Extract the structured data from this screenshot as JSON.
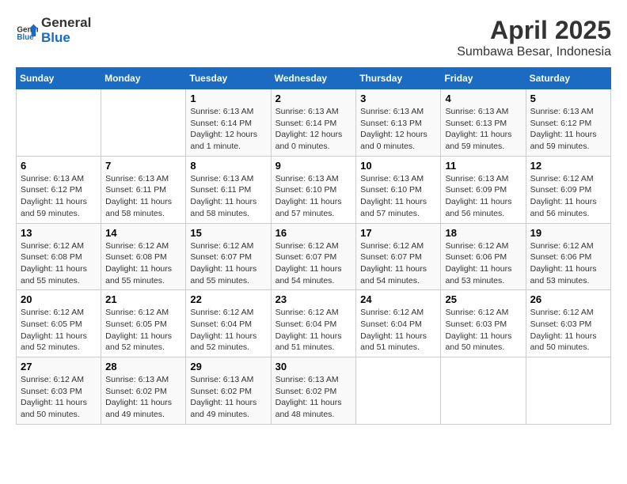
{
  "logo": {
    "line1": "General",
    "line2": "Blue"
  },
  "title": "April 2025",
  "subtitle": "Sumbawa Besar, Indonesia",
  "days_of_week": [
    "Sunday",
    "Monday",
    "Tuesday",
    "Wednesday",
    "Thursday",
    "Friday",
    "Saturday"
  ],
  "weeks": [
    [
      {
        "day": "",
        "info": ""
      },
      {
        "day": "",
        "info": ""
      },
      {
        "day": "1",
        "info": "Sunrise: 6:13 AM\nSunset: 6:14 PM\nDaylight: 12 hours and 1 minute."
      },
      {
        "day": "2",
        "info": "Sunrise: 6:13 AM\nSunset: 6:14 PM\nDaylight: 12 hours and 0 minutes."
      },
      {
        "day": "3",
        "info": "Sunrise: 6:13 AM\nSunset: 6:13 PM\nDaylight: 12 hours and 0 minutes."
      },
      {
        "day": "4",
        "info": "Sunrise: 6:13 AM\nSunset: 6:13 PM\nDaylight: 11 hours and 59 minutes."
      },
      {
        "day": "5",
        "info": "Sunrise: 6:13 AM\nSunset: 6:12 PM\nDaylight: 11 hours and 59 minutes."
      }
    ],
    [
      {
        "day": "6",
        "info": "Sunrise: 6:13 AM\nSunset: 6:12 PM\nDaylight: 11 hours and 59 minutes."
      },
      {
        "day": "7",
        "info": "Sunrise: 6:13 AM\nSunset: 6:11 PM\nDaylight: 11 hours and 58 minutes."
      },
      {
        "day": "8",
        "info": "Sunrise: 6:13 AM\nSunset: 6:11 PM\nDaylight: 11 hours and 58 minutes."
      },
      {
        "day": "9",
        "info": "Sunrise: 6:13 AM\nSunset: 6:10 PM\nDaylight: 11 hours and 57 minutes."
      },
      {
        "day": "10",
        "info": "Sunrise: 6:13 AM\nSunset: 6:10 PM\nDaylight: 11 hours and 57 minutes."
      },
      {
        "day": "11",
        "info": "Sunrise: 6:13 AM\nSunset: 6:09 PM\nDaylight: 11 hours and 56 minutes."
      },
      {
        "day": "12",
        "info": "Sunrise: 6:12 AM\nSunset: 6:09 PM\nDaylight: 11 hours and 56 minutes."
      }
    ],
    [
      {
        "day": "13",
        "info": "Sunrise: 6:12 AM\nSunset: 6:08 PM\nDaylight: 11 hours and 55 minutes."
      },
      {
        "day": "14",
        "info": "Sunrise: 6:12 AM\nSunset: 6:08 PM\nDaylight: 11 hours and 55 minutes."
      },
      {
        "day": "15",
        "info": "Sunrise: 6:12 AM\nSunset: 6:07 PM\nDaylight: 11 hours and 55 minutes."
      },
      {
        "day": "16",
        "info": "Sunrise: 6:12 AM\nSunset: 6:07 PM\nDaylight: 11 hours and 54 minutes."
      },
      {
        "day": "17",
        "info": "Sunrise: 6:12 AM\nSunset: 6:07 PM\nDaylight: 11 hours and 54 minutes."
      },
      {
        "day": "18",
        "info": "Sunrise: 6:12 AM\nSunset: 6:06 PM\nDaylight: 11 hours and 53 minutes."
      },
      {
        "day": "19",
        "info": "Sunrise: 6:12 AM\nSunset: 6:06 PM\nDaylight: 11 hours and 53 minutes."
      }
    ],
    [
      {
        "day": "20",
        "info": "Sunrise: 6:12 AM\nSunset: 6:05 PM\nDaylight: 11 hours and 52 minutes."
      },
      {
        "day": "21",
        "info": "Sunrise: 6:12 AM\nSunset: 6:05 PM\nDaylight: 11 hours and 52 minutes."
      },
      {
        "day": "22",
        "info": "Sunrise: 6:12 AM\nSunset: 6:04 PM\nDaylight: 11 hours and 52 minutes."
      },
      {
        "day": "23",
        "info": "Sunrise: 6:12 AM\nSunset: 6:04 PM\nDaylight: 11 hours and 51 minutes."
      },
      {
        "day": "24",
        "info": "Sunrise: 6:12 AM\nSunset: 6:04 PM\nDaylight: 11 hours and 51 minutes."
      },
      {
        "day": "25",
        "info": "Sunrise: 6:12 AM\nSunset: 6:03 PM\nDaylight: 11 hours and 50 minutes."
      },
      {
        "day": "26",
        "info": "Sunrise: 6:12 AM\nSunset: 6:03 PM\nDaylight: 11 hours and 50 minutes."
      }
    ],
    [
      {
        "day": "27",
        "info": "Sunrise: 6:12 AM\nSunset: 6:03 PM\nDaylight: 11 hours and 50 minutes."
      },
      {
        "day": "28",
        "info": "Sunrise: 6:13 AM\nSunset: 6:02 PM\nDaylight: 11 hours and 49 minutes."
      },
      {
        "day": "29",
        "info": "Sunrise: 6:13 AM\nSunset: 6:02 PM\nDaylight: 11 hours and 49 minutes."
      },
      {
        "day": "30",
        "info": "Sunrise: 6:13 AM\nSunset: 6:02 PM\nDaylight: 11 hours and 48 minutes."
      },
      {
        "day": "",
        "info": ""
      },
      {
        "day": "",
        "info": ""
      },
      {
        "day": "",
        "info": ""
      }
    ]
  ]
}
